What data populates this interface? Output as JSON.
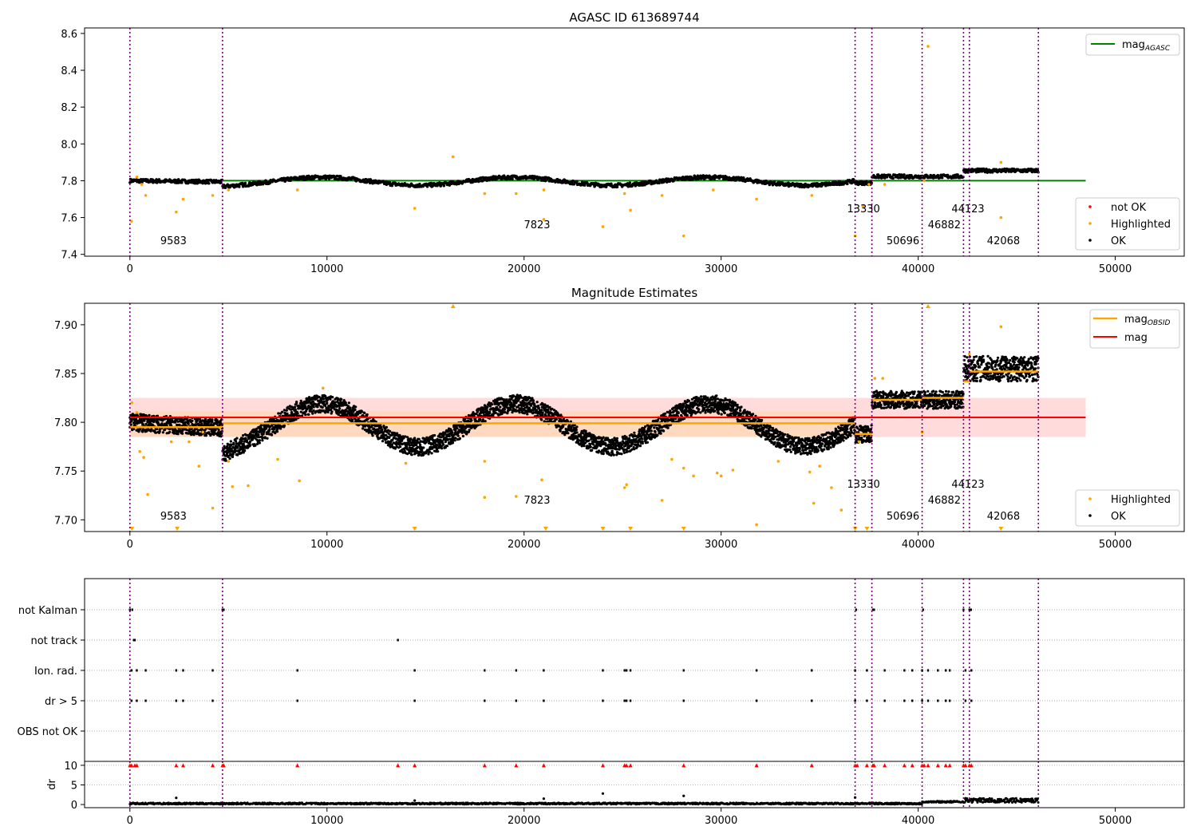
{
  "colors": {
    "not_ok": "#ff0000",
    "highlighted": "#ffa500",
    "ok": "#000000",
    "agasc_line": "#008000",
    "mag_line": "#ff0000",
    "mag_obsid": "#ffa500",
    "obs_boundary": "#800080",
    "band_red": "#ffcccc",
    "band_orange": "#ffd9b3"
  },
  "chart_data": [
    {
      "type": "scatter",
      "title": "AGASC ID 613689744",
      "xlim": [
        -2300,
        53500
      ],
      "ylim": [
        7.39,
        8.63
      ],
      "xticks": [
        0,
        10000,
        20000,
        30000,
        40000,
        50000
      ],
      "yticks": [
        7.4,
        7.6,
        7.8,
        8.0,
        8.2,
        8.4,
        8.6
      ],
      "ytick_labels": [
        "7.4",
        "7.6",
        "7.8",
        "8.0",
        "8.2",
        "8.4",
        "8.6"
      ],
      "mag_agasc": 7.8,
      "legend_lines": [
        {
          "label": "mag",
          "sub": "AGASC",
          "color": "#008000"
        }
      ],
      "legend_points": [
        {
          "label": "not OK",
          "color": "#ff0000"
        },
        {
          "label": "Highlighted",
          "color": "#ffa500"
        },
        {
          "label": "OK",
          "color": "#000000"
        }
      ],
      "highlighted_points": [
        [
          80,
          7.58
        ],
        [
          350,
          7.82
        ],
        [
          600,
          7.78
        ],
        [
          800,
          7.72
        ],
        [
          2350,
          7.63
        ],
        [
          2700,
          7.7
        ],
        [
          4200,
          7.72
        ],
        [
          5000,
          7.75
        ],
        [
          8500,
          7.75
        ],
        [
          14450,
          7.65
        ],
        [
          16400,
          7.93
        ],
        [
          18000,
          7.73
        ],
        [
          19600,
          7.73
        ],
        [
          21000,
          7.59
        ],
        [
          21000,
          7.75
        ],
        [
          24000,
          7.55
        ],
        [
          25100,
          7.73
        ],
        [
          25400,
          7.64
        ],
        [
          27000,
          7.72
        ],
        [
          28100,
          7.5
        ],
        [
          29600,
          7.75
        ],
        [
          31800,
          7.7
        ],
        [
          34600,
          7.72
        ],
        [
          36800,
          7.5
        ],
        [
          37200,
          7.66
        ],
        [
          37500,
          7.78
        ],
        [
          38300,
          7.78
        ],
        [
          40300,
          7.8
        ],
        [
          40500,
          8.53
        ],
        [
          44200,
          7.6
        ],
        [
          44200,
          7.9
        ]
      ]
    },
    {
      "type": "scatter",
      "title": "Magnitude Estimates",
      "xlim": [
        -2300,
        53500
      ],
      "ylim": [
        7.688,
        7.922
      ],
      "xticks": [
        0,
        10000,
        20000,
        30000,
        40000,
        50000
      ],
      "yticks": [
        7.7,
        7.75,
        7.8,
        7.85,
        7.9
      ],
      "ytick_labels": [
        "7.70",
        "7.75",
        "7.80",
        "7.85",
        "7.90"
      ],
      "mag": 7.805,
      "band_red": [
        7.785,
        7.825
      ],
      "band_orange": [
        7.785,
        7.811
      ],
      "mag_obsid": [
        {
          "obsid": "9583",
          "x0": 0,
          "x1": 4700,
          "mag": 7.795
        },
        {
          "obsid": "7823",
          "x0": 4700,
          "x1": 36800,
          "mag": 7.799
        },
        {
          "obsid": "13330",
          "x0": 36800,
          "x1": 37650,
          "mag": 7.788
        },
        {
          "obsid": "50696",
          "x0": 37650,
          "x1": 40200,
          "mag": 7.823
        },
        {
          "obsid": "46882",
          "x0": 40200,
          "x1": 42300,
          "mag": 7.825
        },
        {
          "obsid": "44123",
          "x0": 42300,
          "x1": 42600,
          "mag": 7.842
        },
        {
          "obsid": "42068",
          "x0": 42600,
          "x1": 46100,
          "mag": 7.852
        }
      ],
      "legend_lines": [
        {
          "label": "mag",
          "sub": "OBSID",
          "color": "#ffa500"
        },
        {
          "label": "mag",
          "sub": "",
          "color": "#ff0000"
        }
      ],
      "legend_points": [
        {
          "label": "Highlighted",
          "color": "#ffa500"
        },
        {
          "label": "OK",
          "color": "#000000"
        }
      ],
      "highlighted_points": [
        [
          100,
          7.82
        ],
        [
          350,
          7.81
        ],
        [
          500,
          7.77
        ],
        [
          700,
          7.764
        ],
        [
          900,
          7.726
        ],
        [
          2100,
          7.78
        ],
        [
          3000,
          7.78
        ],
        [
          3500,
          7.755
        ],
        [
          3700,
          7.79
        ],
        [
          4200,
          7.712
        ],
        [
          5000,
          7.76
        ],
        [
          5200,
          7.734
        ],
        [
          6000,
          7.735
        ],
        [
          7500,
          7.762
        ],
        [
          8600,
          7.74
        ],
        [
          9800,
          7.835
        ],
        [
          14000,
          7.758
        ],
        [
          18000,
          7.723
        ],
        [
          18000,
          7.76
        ],
        [
          19600,
          7.724
        ],
        [
          20900,
          7.741
        ],
        [
          25100,
          7.733
        ],
        [
          25200,
          7.736
        ],
        [
          27000,
          7.72
        ],
        [
          27500,
          7.762
        ],
        [
          28100,
          7.753
        ],
        [
          28600,
          7.745
        ],
        [
          29800,
          7.748
        ],
        [
          30000,
          7.745
        ],
        [
          30600,
          7.751
        ],
        [
          31800,
          7.695
        ],
        [
          32900,
          7.76
        ],
        [
          34500,
          7.749
        ],
        [
          34700,
          7.717
        ],
        [
          35000,
          7.755
        ],
        [
          35600,
          7.733
        ],
        [
          36100,
          7.71
        ],
        [
          37000,
          7.78
        ],
        [
          37800,
          7.845
        ],
        [
          38200,
          7.845
        ],
        [
          40200,
          7.79
        ],
        [
          42600,
          7.87
        ],
        [
          44200,
          7.898
        ]
      ],
      "offscale_low": [
        100,
        2400,
        14450,
        21100,
        24000,
        25400,
        28100,
        36800,
        37400,
        44200
      ],
      "offscale_high": [
        16400,
        40500
      ]
    },
    {
      "type": "scatter",
      "title": "",
      "xlim": [
        -2300,
        53500
      ],
      "categories": [
        "not Kalman",
        "not track",
        "Ion. rad.",
        "dr > 5",
        "OBS not OK"
      ],
      "flag_points": {
        "not Kalman": [
          0,
          120,
          4700,
          4760,
          36850,
          37700,
          37760,
          40250,
          42300,
          42600,
          42680
        ],
        "not track": [
          200,
          250,
          13600
        ],
        "Ion. rad.": [
          80,
          350,
          800,
          2350,
          2700,
          4200,
          8500,
          14450,
          18000,
          19600,
          21000,
          24000,
          25100,
          25200,
          25400,
          28100,
          31800,
          34600,
          36800,
          37400,
          38300,
          39300,
          39700,
          40200,
          40500,
          41000,
          41400,
          41600,
          42400,
          42700
        ],
        "dr > 5": [
          80,
          350,
          800,
          2350,
          2700,
          4200,
          8500,
          14450,
          18000,
          19600,
          21000,
          24000,
          25100,
          25200,
          25400,
          28100,
          31800,
          34600,
          36800,
          37400,
          38300,
          39300,
          39700,
          40200,
          40500,
          41000,
          41400,
          41600,
          42400,
          42700
        ],
        "OBS not OK": []
      }
    },
    {
      "type": "scatter",
      "title": "",
      "ylabel": "dr",
      "xlim": [
        -2300,
        53500
      ],
      "ylim": [
        -0.8,
        11
      ],
      "xticks": [
        0,
        10000,
        20000,
        30000,
        40000,
        50000
      ],
      "yticks": [
        0,
        5,
        10
      ],
      "ytick_labels": [
        "0",
        "5",
        "10"
      ],
      "capped_points_x": [
        0,
        80,
        250,
        350,
        2350,
        2700,
        4200,
        4700,
        4760,
        8500,
        13600,
        14450,
        18000,
        19600,
        21000,
        24000,
        25100,
        25200,
        25400,
        28100,
        31800,
        34600,
        36800,
        36900,
        37400,
        37700,
        37760,
        38300,
        39300,
        39700,
        40200,
        40300,
        40500,
        41000,
        41400,
        41600,
        42300,
        42400,
        42600,
        42700
      ],
      "outlier_points": [
        [
          2350,
          1.7
        ],
        [
          21000,
          1.5
        ],
        [
          24000,
          2.8
        ],
        [
          28100,
          2.2
        ],
        [
          36800,
          1.8
        ],
        [
          14450,
          1.0
        ],
        [
          42400,
          1.6
        ],
        [
          42700,
          1.4
        ]
      ]
    }
  ],
  "obs_boundaries": [
    0,
    4700,
    36800,
    37650,
    40200,
    42300,
    42600,
    46100
  ],
  "obsid_labels": [
    {
      "text": "9583",
      "x": 2350,
      "row": 2
    },
    {
      "text": "7823",
      "x": 20800,
      "row": 1
    },
    {
      "text": "13330",
      "x": 37200,
      "row": 0
    },
    {
      "text": "50696",
      "x": 39200,
      "row": 2
    },
    {
      "text": "46882",
      "x": 41300,
      "row": 1
    },
    {
      "text": "44123",
      "x": 42500,
      "row": 0
    },
    {
      "text": "42068",
      "x": 44300,
      "row": 2
    }
  ]
}
